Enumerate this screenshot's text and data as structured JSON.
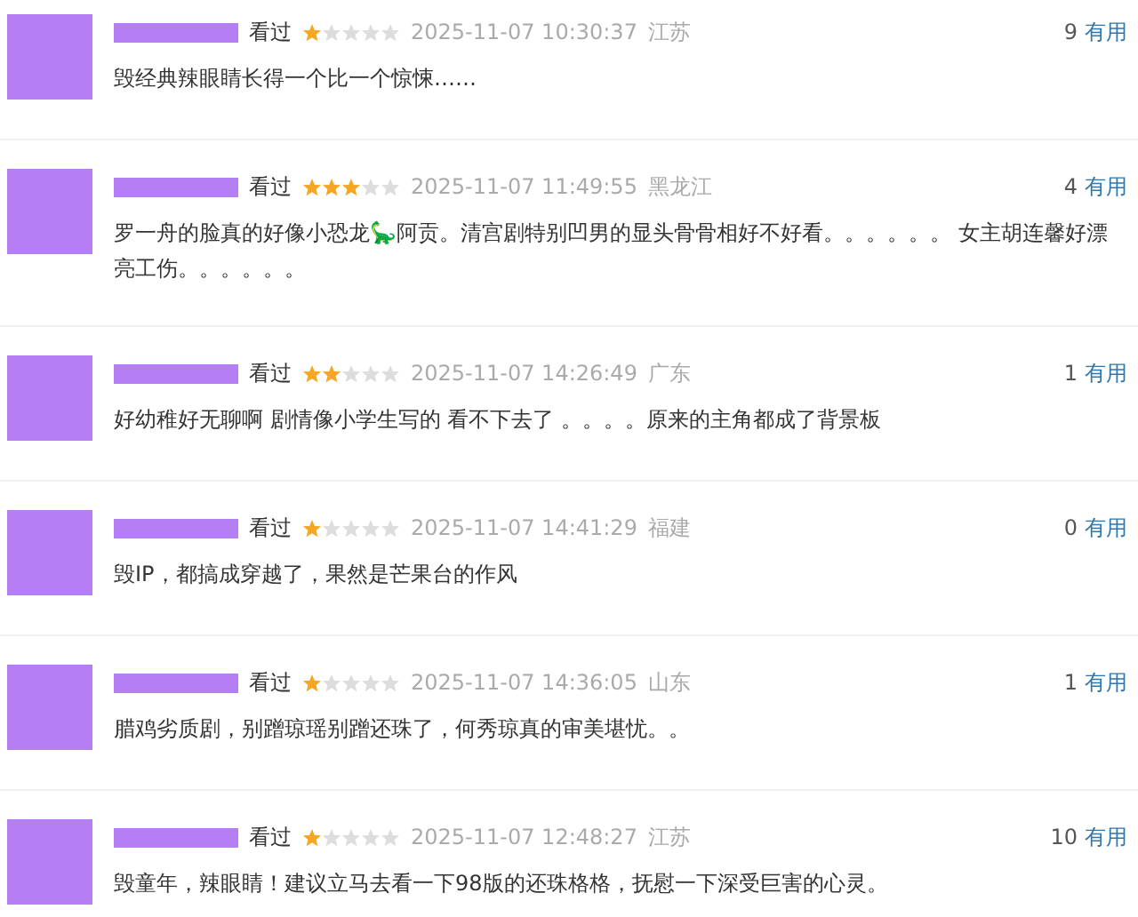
{
  "comments": [
    {
      "status": "看过",
      "stars": 1,
      "time": "2025-11-07 10:30:37",
      "location": "江苏",
      "votes": "9",
      "vote_label": "有用",
      "text": "毁经典辣眼睛长得一个比一个惊悚……"
    },
    {
      "status": "看过",
      "stars": 3,
      "time": "2025-11-07 11:49:55",
      "location": "黑龙江",
      "votes": "4",
      "vote_label": "有用",
      "text": "罗一舟的脸真的好像小恐龙🦕阿贡。清宫剧特别凹男的显头骨骨相好不好看。。。。。。 女主胡连馨好漂亮工伤。。。。。。"
    },
    {
      "status": "看过",
      "stars": 2,
      "time": "2025-11-07 14:26:49",
      "location": "广东",
      "votes": "1",
      "vote_label": "有用",
      "text": "好幼稚好无聊啊 剧情像小学生写的 看不下去了 。。。。原来的主角都成了背景板"
    },
    {
      "status": "看过",
      "stars": 1,
      "time": "2025-11-07 14:41:29",
      "location": "福建",
      "votes": "0",
      "vote_label": "有用",
      "text": "毁IP，都搞成穿越了，果然是芒果台的作风"
    },
    {
      "status": "看过",
      "stars": 1,
      "time": "2025-11-07 14:36:05",
      "location": "山东",
      "votes": "1",
      "vote_label": "有用",
      "text": "腊鸡劣质剧，别蹭琼瑶别蹭还珠了，何秀琼真的审美堪忧。。"
    },
    {
      "status": "看过",
      "stars": 1,
      "time": "2025-11-07 12:48:27",
      "location": "江苏",
      "votes": "10",
      "vote_label": "有用",
      "text": "毁童年，辣眼睛！建议立马去看一下98版的还珠格格，抚慰一下深受巨害的心灵。"
    }
  ]
}
